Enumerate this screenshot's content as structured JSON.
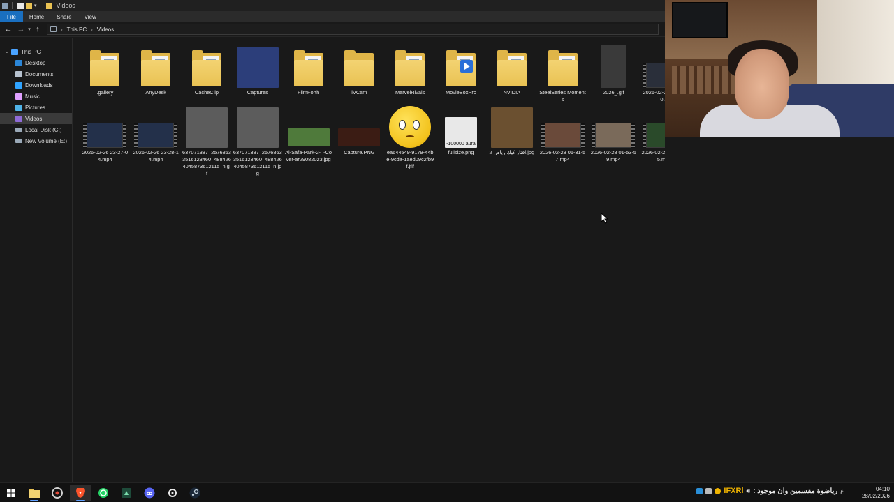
{
  "window": {
    "title": "Videos"
  },
  "ribbon": {
    "tabs": [
      "File",
      "Home",
      "Share",
      "View"
    ]
  },
  "address": {
    "root": "This PC",
    "current": "Videos"
  },
  "nav": {
    "items": [
      {
        "label": "This PC",
        "icon": "pc-icon",
        "color": "#4aa3ff"
      },
      {
        "label": "Desktop",
        "icon": "desktop-icon",
        "color": "#2b86d8"
      },
      {
        "label": "Documents",
        "icon": "documents-icon",
        "color": "#b7c2cf"
      },
      {
        "label": "Downloads",
        "icon": "downloads-icon",
        "color": "#2fa3ff"
      },
      {
        "label": "Music",
        "icon": "music-icon",
        "color": "#e0a0ff"
      },
      {
        "label": "Pictures",
        "icon": "pictures-icon",
        "color": "#4fb3e8"
      },
      {
        "label": "Videos",
        "icon": "videos-icon",
        "color": "#8f6bd8"
      },
      {
        "label": "Local Disk (C:)",
        "icon": "drive-icon",
        "color": "#9aa9b8"
      },
      {
        "label": "New Volume (E:)",
        "icon": "drive-icon",
        "color": "#9aa9b8"
      }
    ]
  },
  "files": {
    "row1": [
      {
        "name": ".gallery",
        "kind": "folder"
      },
      {
        "name": "AnyDesk",
        "kind": "folder"
      },
      {
        "name": "CacheClip",
        "kind": "folder"
      },
      {
        "name": "Captures",
        "kind": "image",
        "thumb_color": "#2c3e7a"
      },
      {
        "name": "FilmForth",
        "kind": "folder"
      },
      {
        "name": "iVCam",
        "kind": "folder-plain"
      },
      {
        "name": "MarvelRivals",
        "kind": "folder"
      },
      {
        "name": "MovieBoxPro",
        "kind": "folder-app"
      },
      {
        "name": "NVIDIA",
        "kind": "folder"
      },
      {
        "name": "SteelSeries Moments",
        "kind": "folder"
      },
      {
        "name": "2026_.gif",
        "kind": "image",
        "thumb_color": "#3a3a3a"
      },
      {
        "name": "2026-02-28 22-44-0…",
        "kind": "video",
        "thumb_color": "#2a2f3a"
      }
    ],
    "row2": [
      {
        "name": "2026-02-26 23-27-04.mp4",
        "kind": "video",
        "thumb_color": "#23304a"
      },
      {
        "name": "2026-02-26 23-28-14.mp4",
        "kind": "video",
        "thumb_color": "#23304a"
      },
      {
        "name": "637071387_25768633516123460_4884264045873612115_n.gif",
        "kind": "image",
        "thumb_color": "#5c5c5c"
      },
      {
        "name": "637071387_25768633516123460_4884264045873612115_n.jpg",
        "kind": "image",
        "thumb_color": "#5c5c5c"
      },
      {
        "name": "Al-Safa-Park-2-_-Cover-ar29082023.jpg",
        "kind": "image-wide",
        "thumb_color": "#4f7a3b"
      },
      {
        "name": "Capture.PNG",
        "kind": "image-wide",
        "thumb_color": "#3b1c14"
      },
      {
        "name": "ea644549-9179-44be-9cda-1aed09c2fb9f.jfif",
        "kind": "emoji",
        "thumb_color": "#f2c21c"
      },
      {
        "name": "fullsize.png",
        "kind": "image",
        "thumb_color": "#e8e8e8",
        "caption": "-100000 aura"
      },
      {
        "name": "افتار كيك رياض 2.jpg",
        "kind": "image",
        "thumb_color": "#6b5030"
      },
      {
        "name": "2026-02-28 01-31-57.mp4",
        "kind": "video",
        "thumb_color": "#6a4a3a"
      },
      {
        "name": "2026-02-28 01-53-59.mp4",
        "kind": "video",
        "thumb_color": "#7a6a5a"
      },
      {
        "name": "2026-02-28 03-00-25.mp4",
        "kind": "video",
        "thumb_color": "#2a4a2a"
      }
    ]
  },
  "taskbar": {
    "apps": [
      "start-icon",
      "file-explorer-icon",
      "chrome-icon",
      "brave-icon",
      "whatsapp-icon",
      "app-icon",
      "discord-icon",
      "steelseries-icon",
      "steam-icon"
    ],
    "tray_text": "IFXRl",
    "tray_arabic": "رياضوة مقسمين وان موجود :",
    "lang": "ع",
    "time": "04:10",
    "date": "28/02/2026"
  }
}
